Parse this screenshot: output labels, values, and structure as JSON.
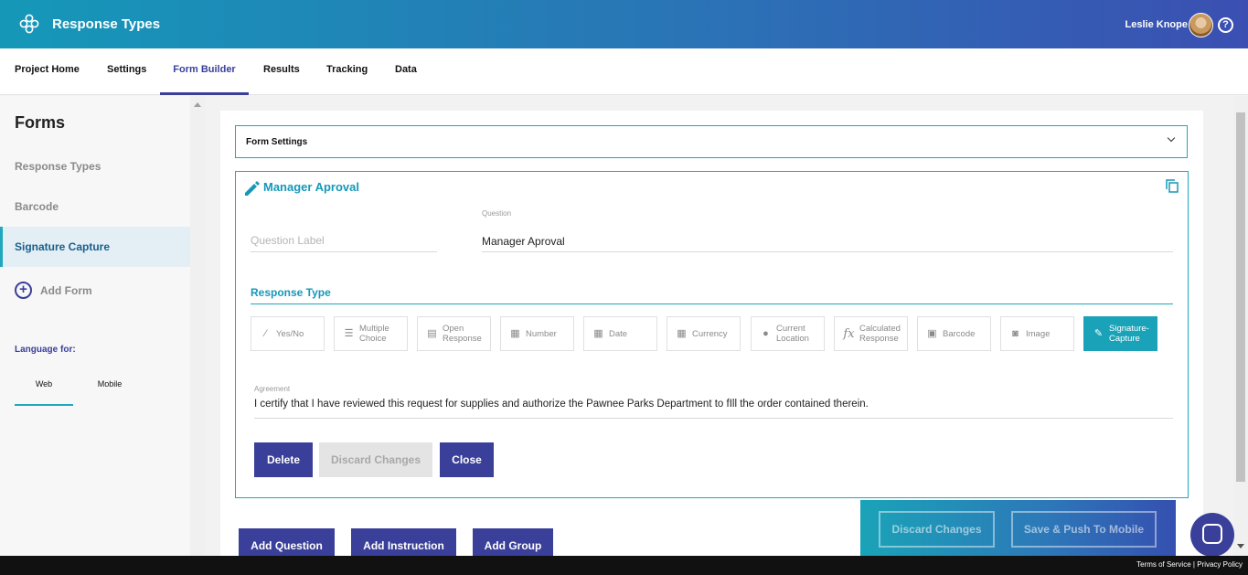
{
  "header": {
    "app_title": "Response Types",
    "user_name": "Leslie Knope",
    "colors": {
      "gradient_start": "#1598b8",
      "gradient_end": "#3b4fb2"
    }
  },
  "nav": {
    "items": [
      "Project Home",
      "Settings",
      "Form Builder",
      "Results",
      "Tracking",
      "Data"
    ],
    "active": "Form Builder"
  },
  "sidebar": {
    "title": "Forms",
    "items": [
      "Response Types",
      "Barcode",
      "Signature Capture"
    ],
    "active": "Signature Capture",
    "add_form_label": "Add Form",
    "language_label": "Language for:",
    "language_tabs": [
      "Web",
      "Mobile"
    ],
    "language_active": "Web"
  },
  "form_settings": {
    "label": "Form Settings"
  },
  "question_card": {
    "title": "Manager Aproval",
    "question_label_placeholder": "Question Label",
    "question_caption": "Question",
    "question_value": "Manager Aproval",
    "response_type_label": "Response Type",
    "response_types": [
      {
        "label": "Yes/No",
        "icon": "yes-no-icon"
      },
      {
        "label": "Multiple Choice",
        "icon": "list-icon"
      },
      {
        "label": "Open Response",
        "icon": "open-response-icon"
      },
      {
        "label": "Number",
        "icon": "calculator-icon"
      },
      {
        "label": "Date",
        "icon": "calendar-icon"
      },
      {
        "label": "Currency",
        "icon": "calculator-icon"
      },
      {
        "label": "Current Location",
        "icon": "location-pin-icon"
      },
      {
        "label": "Calculated Response",
        "icon": "fx-icon"
      },
      {
        "label": "Barcode",
        "icon": "barcode-icon"
      },
      {
        "label": "Image",
        "icon": "camera-icon"
      },
      {
        "label": "Signature-Capture",
        "icon": "pen-icon"
      }
    ],
    "response_type_active": "Signature-Capture",
    "agreement_caption": "Agreement",
    "agreement_text": "I certify that I have reviewed this request for supplies and authorize the Pawnee Parks Department to fIll the order contained therein.",
    "buttons": {
      "delete": "Delete",
      "discard": "Discard Changes",
      "close": "Close"
    }
  },
  "bottom_actions": {
    "add_question": "Add Question",
    "add_instruction": "Add Instruction",
    "add_group": "Add Group"
  },
  "push_panel": {
    "discard": "Discard Changes",
    "save_push": "Save & Push To Mobile"
  },
  "footer": {
    "terms": "Terms of Service",
    "separator": "|",
    "privacy": "Privacy Policy"
  },
  "accent_colors": {
    "primary": "#3a3f9a",
    "teal": "#1aa3b8"
  }
}
